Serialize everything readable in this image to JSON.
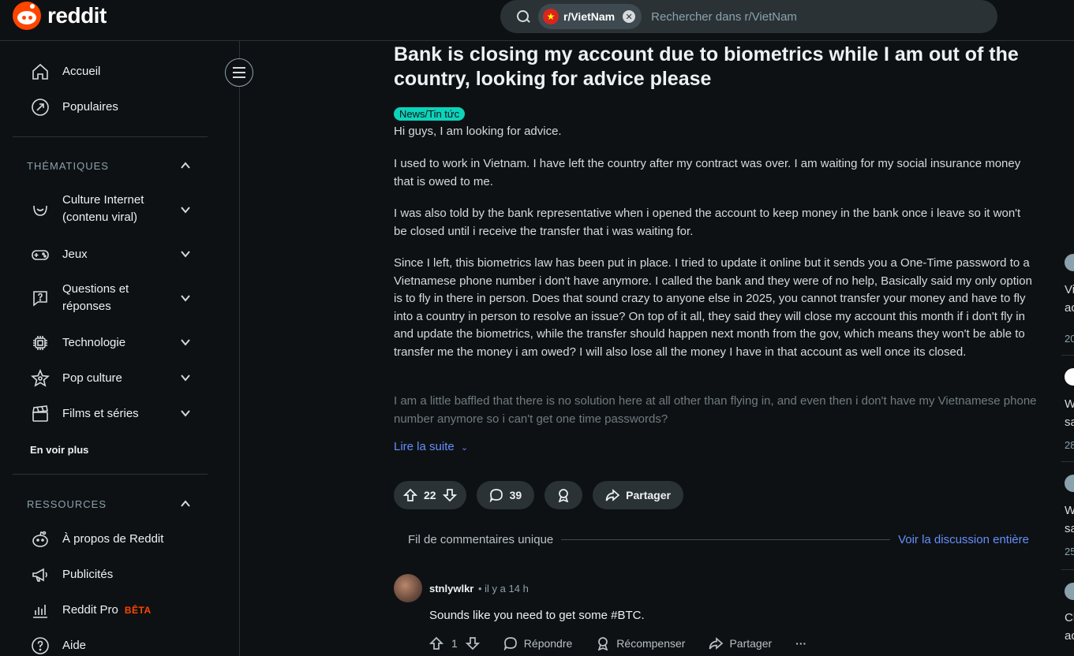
{
  "header": {
    "logo_text": "reddit",
    "search": {
      "chip_label": "r/VietNam",
      "placeholder": "Rechercher dans r/VietNam"
    }
  },
  "sidebar": {
    "top_items": [
      {
        "label": "Accueil",
        "icon": "home-icon"
      },
      {
        "label": "Populaires",
        "icon": "popular-icon"
      }
    ],
    "topics_header": "THÉMATIQUES",
    "topics": [
      {
        "label": "Culture Internet (contenu viral)",
        "icon": "smile-icon"
      },
      {
        "label": "Jeux",
        "icon": "gamepad-icon"
      },
      {
        "label": "Questions et réponses",
        "icon": "question-icon"
      },
      {
        "label": "Technologie",
        "icon": "chip-icon"
      },
      {
        "label": "Pop culture",
        "icon": "star-icon"
      },
      {
        "label": "Films et séries",
        "icon": "clapper-icon"
      }
    ],
    "see_more": "En voir plus",
    "resources_header": "RESSOURCES",
    "resources": [
      {
        "label": "À propos de Reddit",
        "icon": "reddit-icon"
      },
      {
        "label": "Publicités",
        "icon": "megaphone-icon"
      },
      {
        "label": "Reddit Pro",
        "icon": "chart-icon",
        "badge": "BÊTA"
      },
      {
        "label": "Aide",
        "icon": "help-icon"
      }
    ]
  },
  "post": {
    "title": "Bank is closing my account due to biometrics while I am out of the country, looking for advice please",
    "flair": "News/Tin tức",
    "paragraphs": [
      "Hi guys, I am looking for advice.",
      "I used to work in Vietnam. I have left the country after my contract was over. I am waiting for my social insurance money that is owed to me.",
      "I was also told by the bank representative when i opened the account to keep money in the bank once i leave so it won't be closed until i receive the transfer that i was waiting for.",
      "Since I left, this biometrics law has been put in place. I tried to update it online but it sends you a One-Time password to a Vietnamese phone number i don't have anymore. I called the bank and they were of no help, Basically said my only option is to fly in there in person. Does that sound crazy to anyone else in 2025, you cannot transfer your money and have to fly into a country in person to resolve an issue? On top of it all, they said they will close my account this month if i don't fly in and update the biometrics, while the transfer should happen next month from the gov, which means they won't be able to transfer me the money i am owed? I will also lose all the money I have in that account as well once its closed.",
      "I am a little baffled that there is no solution here at all other than flying in, and even then i don't have my Vietnamese phone number anymore so i can't get one time passwords?"
    ],
    "read_more": "Lire la suite",
    "votes": "22",
    "comments": "39",
    "share": "Partager"
  },
  "thread": {
    "label": "Fil de commentaires unique",
    "link": "Voir la discussion entière"
  },
  "comment": {
    "user": "stnlywlkr",
    "meta": "• il y a 14 h",
    "text": "Sounds like you need to get some #BTC.",
    "votes": "1",
    "reply": "Répondre",
    "award": "Récompenser",
    "share": "Partager",
    "more": "···"
  },
  "right_column": {
    "items": [
      {
        "line1": "Vi",
        "line2": "ac",
        "line3": "20"
      },
      {
        "line1": "W",
        "line2": "sa",
        "line3": "28"
      },
      {
        "line1": "W",
        "line2": "sa",
        "line3": "25"
      },
      {
        "line1": "Cl",
        "line2": "ac",
        "line3": ""
      }
    ]
  }
}
